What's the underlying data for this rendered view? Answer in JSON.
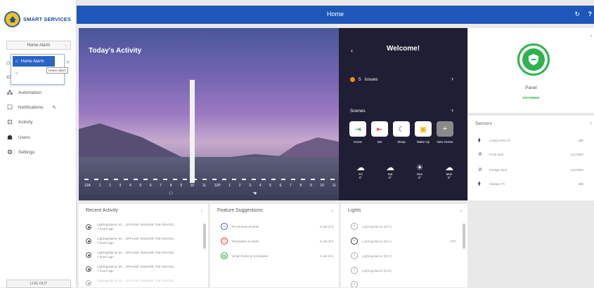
{
  "brand": {
    "name": "SMART SERVICES",
    "logo_icon": "brand-logo-icon"
  },
  "sidebar": {
    "location_select": "Home Alarm",
    "dropdown": {
      "selected": "Home Alarm",
      "tooltip": "Home Alarm"
    },
    "nav": [
      {
        "label": "Automation",
        "icon": "automation-icon"
      },
      {
        "label": "Notifications",
        "icon": "notifications-icon"
      },
      {
        "label": "Activity",
        "icon": "activity-icon"
      },
      {
        "label": "Users",
        "icon": "users-icon"
      },
      {
        "label": "Settings",
        "icon": "settings-icon"
      }
    ],
    "logout": "LOG OUT"
  },
  "header": {
    "title": "Home"
  },
  "activity": {
    "title": "Today's Activity",
    "hours": [
      "12A",
      "1",
      "2",
      "3",
      "4",
      "5",
      "6",
      "7",
      "8",
      "9",
      "10",
      "11",
      "12P",
      "1",
      "2",
      "3",
      "4",
      "5",
      "6",
      "7",
      "8",
      "9",
      "10",
      "11"
    ]
  },
  "welcome": {
    "title": "Welcome!",
    "issues_count": "5",
    "issues_label": "Issues",
    "scenes_label": "Scenes",
    "scenes": [
      {
        "label": "Home",
        "icon": "home-arrive-icon",
        "color": "#25a34a"
      },
      {
        "label": "Set",
        "icon": "away-icon",
        "color": "#d9312b"
      },
      {
        "label": "Sleep",
        "icon": "moon-icon",
        "color": "#2a63c4"
      },
      {
        "label": "Wake Up",
        "icon": "wake-icon",
        "color": "#e6b800"
      },
      {
        "label": "New Scene",
        "icon": "plus-icon",
        "color": "#9a9a9a"
      }
    ],
    "weather": [
      {
        "day": "Fri",
        "temp": "0°",
        "icon": "snow-cloud-icon"
      },
      {
        "day": "Sat",
        "temp": "0°",
        "icon": "snow-cloud-icon"
      },
      {
        "day": "Sun",
        "temp": "0°",
        "icon": "sun-cloud-icon"
      },
      {
        "day": "Mon",
        "temp": "0°",
        "icon": "snow-cloud-icon"
      }
    ]
  },
  "panel": {
    "label": "Panel",
    "status": "DISARMED",
    "status_color": "#2fb24f"
  },
  "sensors": {
    "title": "Sensors",
    "items": [
      {
        "name": "Living room (7)",
        "state": "Idle"
      },
      {
        "name": "Front door",
        "state": "CLOSED"
      },
      {
        "name": "Garage door",
        "state": "CLOSED"
      },
      {
        "name": "Garage (7)",
        "state": "Idle"
      }
    ]
  },
  "recent_activity": {
    "title": "Recent Activity",
    "items": [
      {
        "line1": "LightAppliance (D...   OFFLINE: ENSURE THE DEVICE...",
        "line2": "7 hours ago"
      },
      {
        "line1": "LightAppliance (D...   OFFLINE: ENSURE THE DEVICE...",
        "line2": "7 hours ago"
      },
      {
        "line1": "LightAppliance (D...   OFFLINE: ENSURE THE DEVICE...",
        "line2": "7 hours ago"
      },
      {
        "line1": "LightAppliance (D...   OFFLINE: ENSURE THE DEVICE...",
        "line2": "7 hours ago"
      },
      {
        "line1": "LightAppliance (D...   OFFLINE: ENSURE THE DEVICE...",
        "line2": ""
      }
    ]
  },
  "feature_suggestions": {
    "title": "Feature Suggestions",
    "items": [
      {
        "name": "Pro Enhancements",
        "count": "0 out of 3",
        "color": "#2a63c4"
      },
      {
        "name": "Reminders & Alerts",
        "count": "0 out of 6",
        "color": "#d9312b"
      },
      {
        "name": "Smart Rules & Schedules",
        "count": "0 out of 6",
        "color": "#25a34a"
      }
    ]
  },
  "lights": {
    "title": "Lights",
    "items": [
      {
        "name": "LightAppliance (D17)",
        "state": ""
      },
      {
        "name": "LightAppliance (D17)",
        "state": "OFF"
      },
      {
        "name": "LightAppliance (D17)",
        "state": ""
      },
      {
        "name": "LightAppliance (D13)",
        "state": ""
      },
      {
        "name": "",
        "state": ""
      }
    ]
  }
}
